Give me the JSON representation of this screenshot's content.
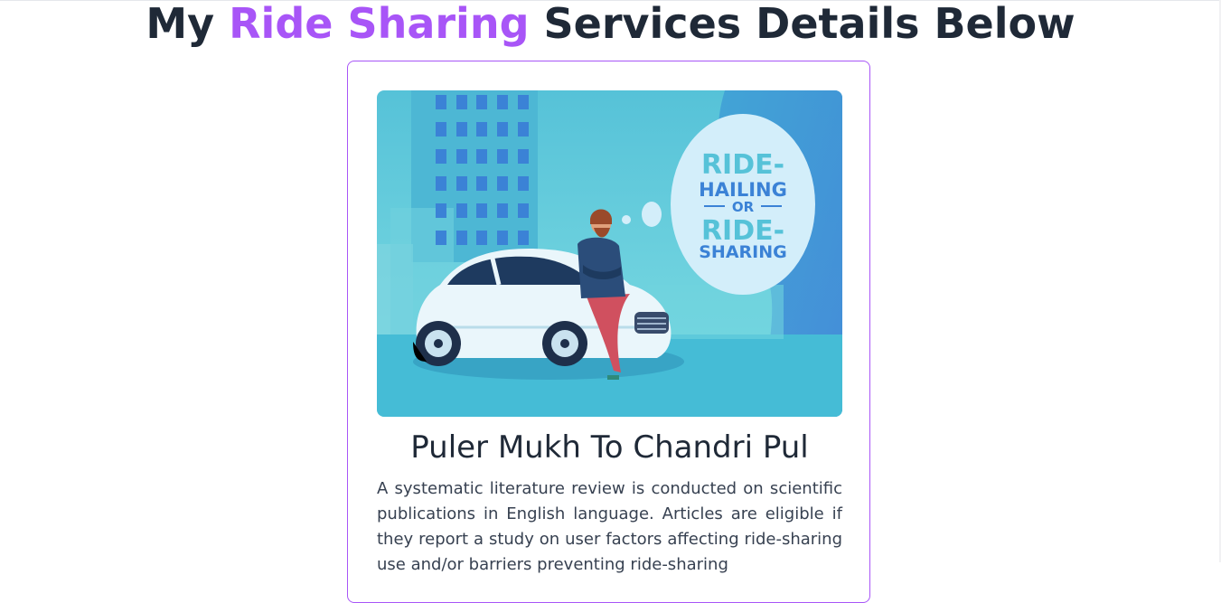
{
  "header": {
    "title_prefix": "My",
    "title_accent": "Ride Sharing",
    "title_suffix": "Services Details Below"
  },
  "colors": {
    "accent": "#a855f7",
    "text": "#1f2937",
    "hero_bg": "#5ccbdc"
  },
  "card": {
    "image": {
      "bubble_line1": "RIDE-",
      "bubble_line2": "HAILING",
      "bubble_line3": "OR",
      "bubble_line4": "RIDE-",
      "bubble_line5": "SHARING"
    },
    "title": "Puler Mukh To Chandri Pul",
    "description": "A systematic literature review is conducted on scientific publications in English language. Articles are eligible if they report a study on user factors affecting ride-sharing use and/or barriers preventing ride-sharing"
  }
}
